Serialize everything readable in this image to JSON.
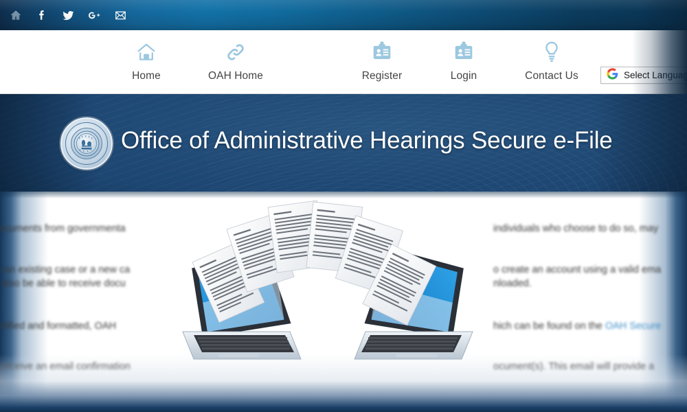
{
  "topbar": {
    "icons": [
      {
        "name": "home-icon",
        "glyph": "home"
      },
      {
        "name": "facebook-icon",
        "glyph": "f"
      },
      {
        "name": "twitter-icon",
        "glyph": "twitter"
      },
      {
        "name": "google-plus-icon",
        "glyph": "g+"
      },
      {
        "name": "email-icon",
        "glyph": "envelope"
      }
    ]
  },
  "nav": {
    "items": [
      {
        "label": "Home",
        "icon": "house-icon"
      },
      {
        "label": "OAH Home",
        "icon": "link-chain-icon"
      },
      {
        "label": "Register",
        "icon": "id-card-icon"
      },
      {
        "label": "Login",
        "icon": "id-card-icon"
      },
      {
        "label": "Contact Us",
        "icon": "lightbulb-icon"
      }
    ]
  },
  "translate": {
    "logo": "G",
    "label": "Select Language",
    "colors": {
      "blue": "#4285F4",
      "red": "#EA4335",
      "yellow": "#FBBC05",
      "green": "#34A853"
    }
  },
  "banner": {
    "title": "Office of Administrative Hearings Secure e-File",
    "seal_name": "state-seal",
    "background_color": "#1d4672"
  },
  "content": {
    "left_lines": [
      "e documents from governmenta",
      "d to an existing case or a new ca",
      "will also be able to receive docu",
      "identified and formatted, OAH",
      "uld receive an email confirmation"
    ],
    "right_lines": [
      "individuals who choose to do so, may",
      "o create an account using a valid ema",
      "nloaded.",
      "hich can be found on the ",
      "ocument(s). This email will provide a"
    ],
    "link_text": "OAH Secure",
    "link_color": "#3f8fca",
    "illustration": "two-laptops-exchanging-documents"
  },
  "theme": {
    "navy": "#1d4672",
    "icon_blue": "#9cc8e0",
    "text_gray": "#444444"
  }
}
